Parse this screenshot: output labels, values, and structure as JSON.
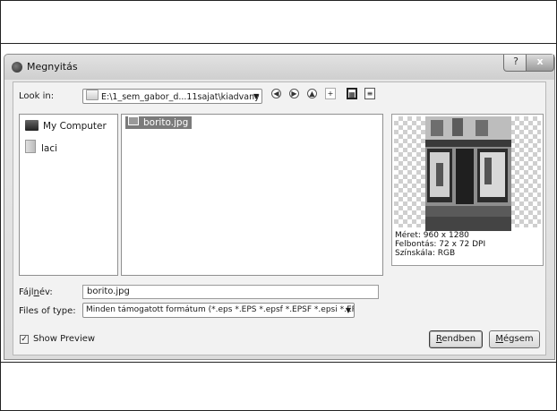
{
  "dialog": {
    "title": "Megnyitás",
    "help_glyph": "?",
    "close_glyph": "x"
  },
  "toolbar": {
    "look_in_label": "Look in:",
    "path": "E:\\1_sem_gabor_d...11sajat\\kiadvany",
    "back_glyph": "◀",
    "forward_glyph": "▶",
    "up_glyph": "▲",
    "new_folder_glyph": "+",
    "detail_view_glyph": "▦",
    "list_view_glyph": "≡"
  },
  "sidebar": {
    "items": [
      {
        "label": "My Computer",
        "icon": "computer-icon"
      },
      {
        "label": "laci",
        "icon": "user-folder-icon"
      }
    ]
  },
  "files": [
    {
      "name": "borito.jpg",
      "selected": true
    }
  ],
  "preview": {
    "size_line": "Méret: 960 x 1280",
    "resolution_line": "Felbontás: 72 x 72 DPI",
    "colorspace_line": "Színskála: RGB"
  },
  "filename": {
    "label_prefix": "Fájl",
    "label_mnemonic": "n",
    "label_suffix": "év:",
    "value": "borito.jpg"
  },
  "filetype": {
    "label": "Files of type:",
    "value": "Minden támogatott formátum (*.eps *.EPS *.epsf *.EPSF *.epsi *.EPSI *.e"
  },
  "show_preview": {
    "label": "Show Preview",
    "checked": true,
    "check_glyph": "✓"
  },
  "buttons": {
    "ok_mnemonic": "R",
    "ok_rest": "endben",
    "cancel_mnemonic": "M",
    "cancel_rest": "égsem"
  },
  "colors": {
    "selection": "#7b7b7b",
    "window_bg": "#dcdcdc"
  }
}
